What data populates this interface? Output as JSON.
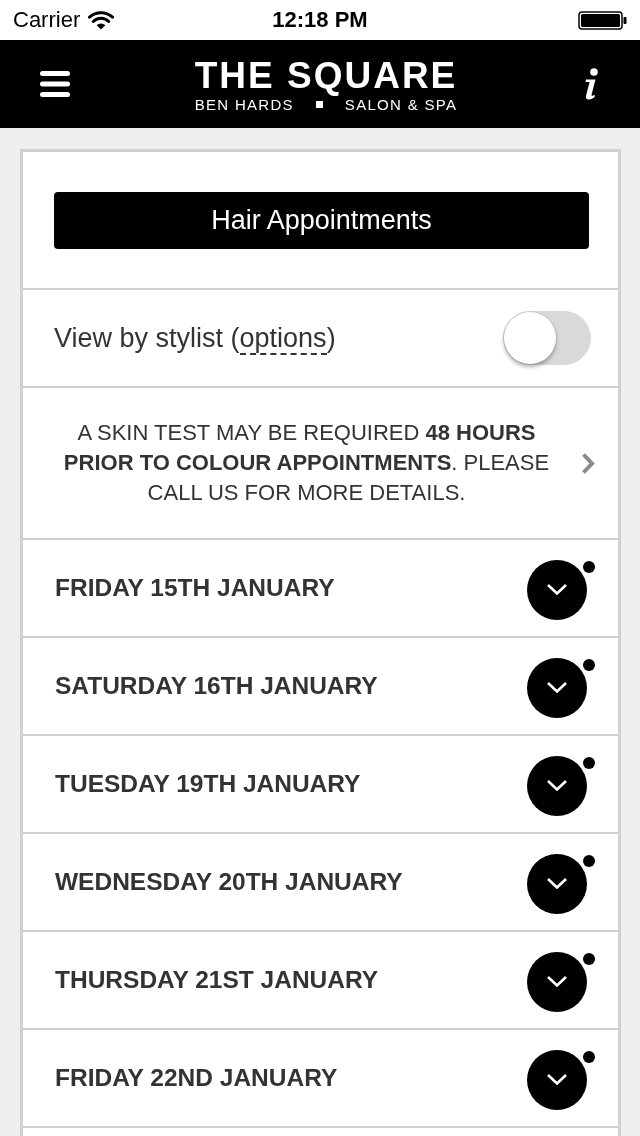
{
  "status_bar": {
    "carrier": "Carrier",
    "time": "12:18 PM"
  },
  "header": {
    "title": "THE SQUARE",
    "subtitle_left": "BEN HARDS",
    "subtitle_right": "SALON & SPA"
  },
  "category_button": {
    "label": "Hair Appointments"
  },
  "stylist_toggle": {
    "label_before": "View by stylist (",
    "link": "options",
    "label_after": ")",
    "on": false
  },
  "notice": {
    "text": "A SKIN TEST MAY BE REQUIRED **48 HOURS PRIOR TO COLOUR APPOINTMENTS**. PLEASE CALL US FOR MORE DETAILS."
  },
  "days": [
    {
      "label": "FRIDAY 15TH JANUARY",
      "expanded": false,
      "notification_dot": true
    },
    {
      "label": "SATURDAY 16TH JANUARY",
      "expanded": false,
      "notification_dot": true
    },
    {
      "label": "TUESDAY 19TH JANUARY",
      "expanded": false,
      "notification_dot": true
    },
    {
      "label": "WEDNESDAY 20TH JANUARY",
      "expanded": false,
      "notification_dot": true
    },
    {
      "label": "THURSDAY 21ST JANUARY",
      "expanded": false,
      "notification_dot": true
    },
    {
      "label": "FRIDAY 22ND JANUARY",
      "expanded": false,
      "notification_dot": true
    }
  ]
}
